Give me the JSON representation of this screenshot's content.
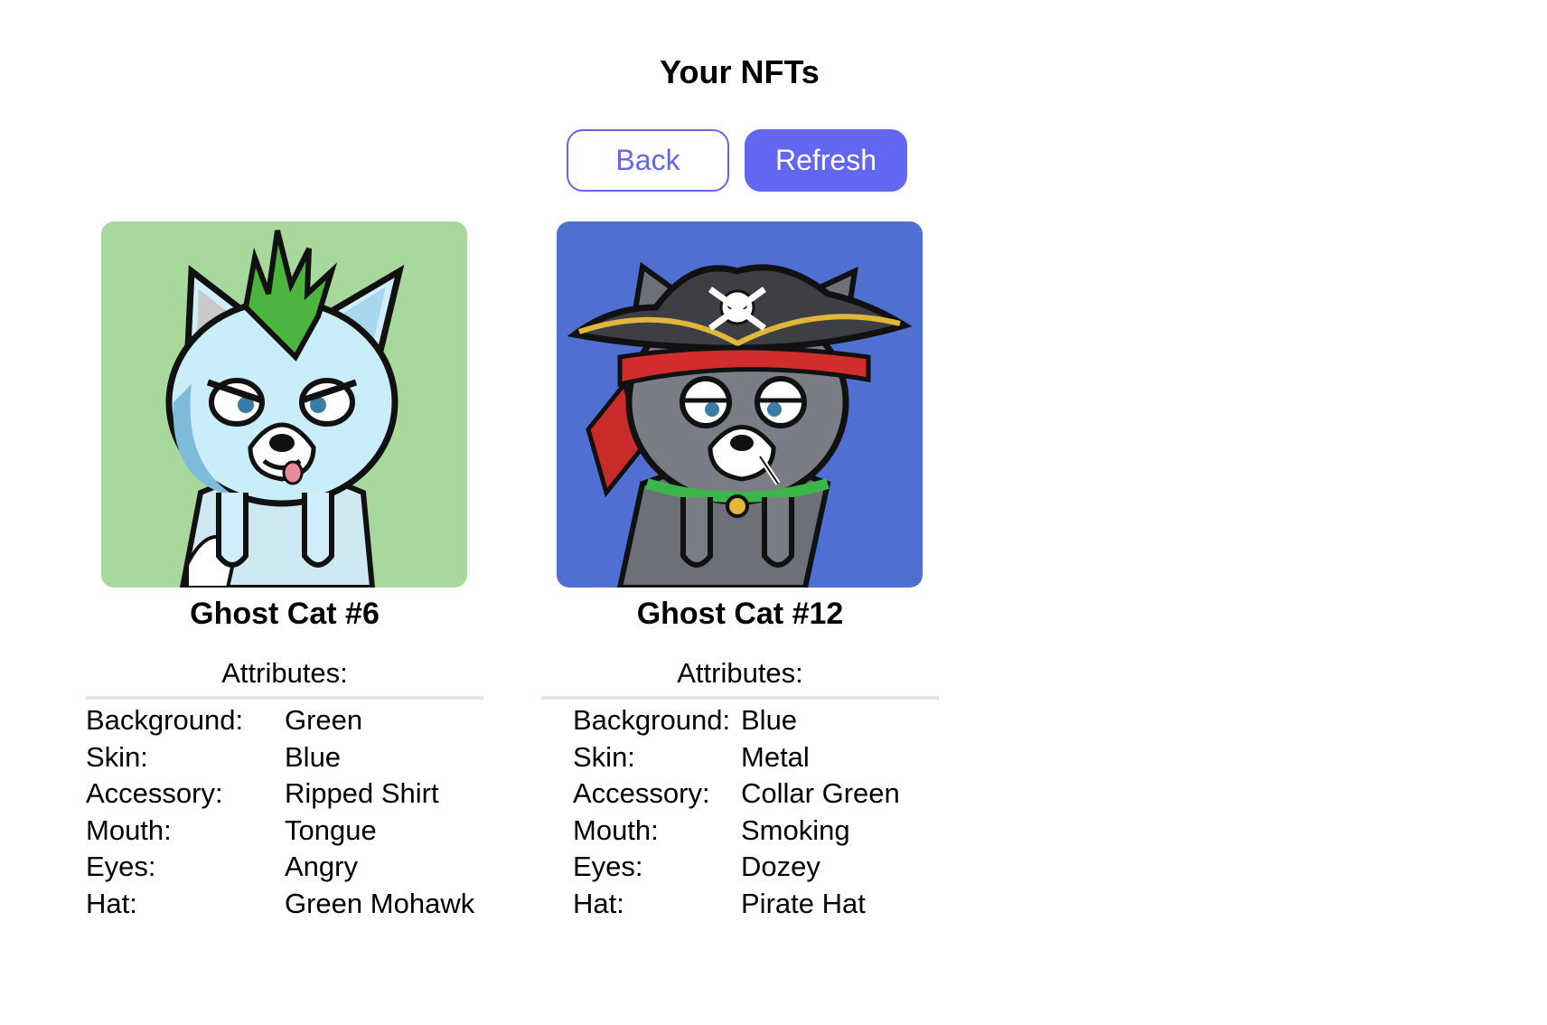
{
  "page": {
    "title": "Your NFTs"
  },
  "toolbar": {
    "back_label": "Back",
    "refresh_label": "Refresh"
  },
  "colors": {
    "accent": "#6366f1",
    "card1_background": "#a8d89b",
    "card2_background": "#4f6fd3"
  },
  "nfts": [
    {
      "name": "Ghost Cat #6",
      "image_icon": "ghost-cat-green-mohawk-image",
      "attributes_heading": "Attributes:",
      "attributes": [
        {
          "key": "Background:",
          "value": "Green"
        },
        {
          "key": "Skin:",
          "value": "Blue"
        },
        {
          "key": "Accessory:",
          "value": "Ripped Shirt"
        },
        {
          "key": "Mouth:",
          "value": "Tongue"
        },
        {
          "key": "Eyes:",
          "value": "Angry"
        },
        {
          "key": "Hat:",
          "value": "Green Mohawk"
        }
      ]
    },
    {
      "name": "Ghost Cat #12",
      "image_icon": "ghost-cat-pirate-hat-image",
      "attributes_heading": "Attributes:",
      "attributes": [
        {
          "key": "Background:",
          "value": "Blue"
        },
        {
          "key": "Skin:",
          "value": "Metal"
        },
        {
          "key": "Accessory:",
          "value": "Collar Green"
        },
        {
          "key": "Mouth:",
          "value": "Smoking"
        },
        {
          "key": "Eyes:",
          "value": "Dozey"
        },
        {
          "key": "Hat:",
          "value": "Pirate Hat"
        }
      ]
    }
  ]
}
